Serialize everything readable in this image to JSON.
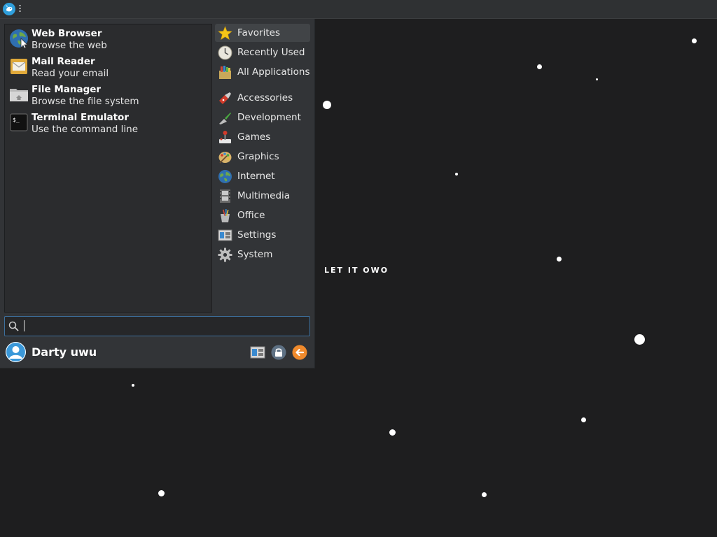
{
  "wallpaper": {
    "text": "LET IT OWO"
  },
  "panel": {
    "logo_icon": "xfce-logo-icon"
  },
  "favorites": [
    {
      "name": "Web Browser",
      "description": "Browse the web",
      "icon": "globe-icon"
    },
    {
      "name": "Mail Reader",
      "description": "Read your email",
      "icon": "envelope-icon"
    },
    {
      "name": "File Manager",
      "description": "Browse the file system",
      "icon": "folder-icon"
    },
    {
      "name": "Terminal Emulator",
      "description": "Use the command line",
      "icon": "terminal-icon"
    }
  ],
  "categories": [
    {
      "label": "Favorites",
      "icon": "star-icon",
      "active": true
    },
    {
      "label": "Recently Used",
      "icon": "clock-icon"
    },
    {
      "label": "All Applications",
      "icon": "applications-icon"
    },
    {
      "label": "Accessories",
      "icon": "swiss-knife-icon"
    },
    {
      "label": "Development",
      "icon": "trowel-icon"
    },
    {
      "label": "Games",
      "icon": "joystick-icon"
    },
    {
      "label": "Graphics",
      "icon": "palette-icon"
    },
    {
      "label": "Internet",
      "icon": "globe-icon"
    },
    {
      "label": "Multimedia",
      "icon": "film-icon"
    },
    {
      "label": "Office",
      "icon": "office-icon"
    },
    {
      "label": "Settings",
      "icon": "settings-icon"
    },
    {
      "label": "System",
      "icon": "gear-icon"
    }
  ],
  "search": {
    "value": "",
    "placeholder": ""
  },
  "user": {
    "name": "Darty uwu"
  },
  "actions": [
    {
      "name": "settings-manager-button",
      "icon": "settings-icon"
    },
    {
      "name": "lock-screen-button",
      "icon": "lock-icon"
    },
    {
      "name": "log-out-button",
      "icon": "logout-arrow-icon"
    }
  ],
  "colors": {
    "desktop_bg": "#1e1e1f",
    "menu_bg": "#323437",
    "accent": "#3d6f9c",
    "logout": "#f08a2c"
  }
}
